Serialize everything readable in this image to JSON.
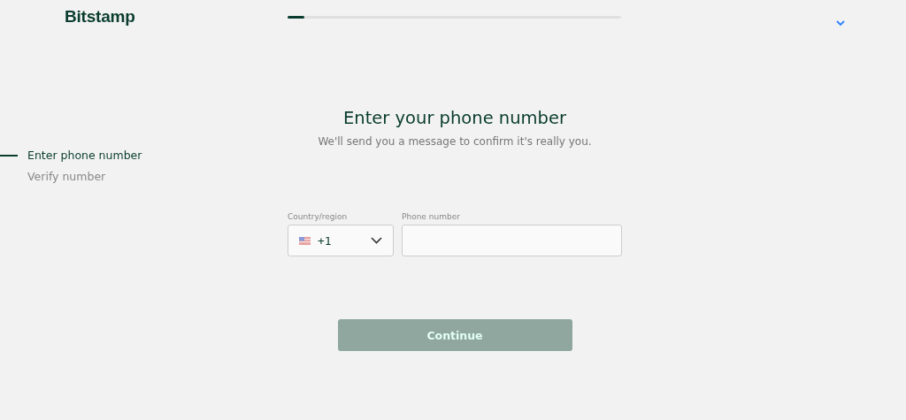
{
  "header": {
    "logo": "Bitstamp",
    "progress": {
      "level": 0.05
    }
  },
  "steps": [
    {
      "label": "Enter phone number",
      "selected": true
    },
    {
      "label": "Verify number",
      "selected": false
    }
  ],
  "form": {
    "title": "Enter your phone number",
    "subtitle": "We'll send you a message to confirm it's really you.",
    "country": {
      "label": "Country/region",
      "value": "+1"
    },
    "phone": {
      "label": "Phone number"
    },
    "continue_button": {
      "label": "Continue",
      "disabled": true
    }
  }
}
